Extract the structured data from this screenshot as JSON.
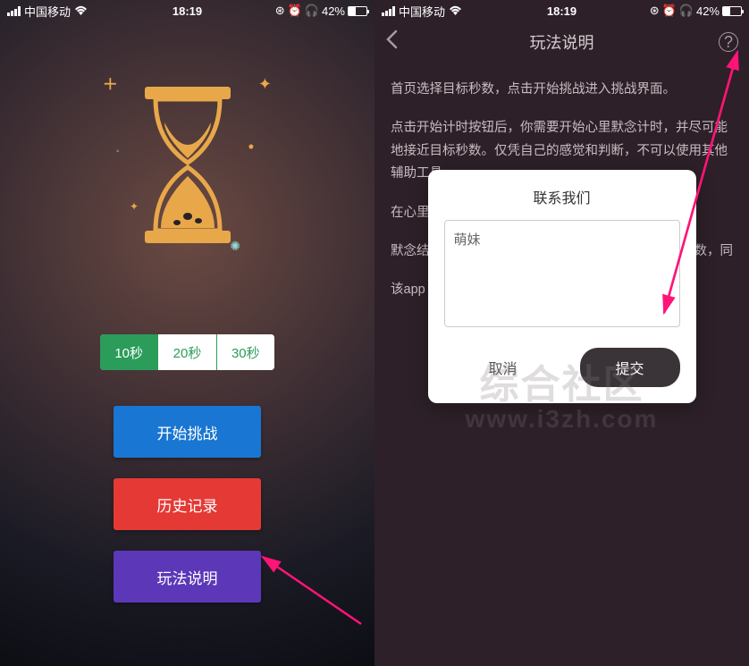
{
  "status": {
    "carrier": "中国移动",
    "time": "18:19",
    "battery_pct": "42%"
  },
  "left": {
    "segments": {
      "opt1": "10秒",
      "opt2": "20秒",
      "opt3": "30秒"
    },
    "buttons": {
      "start": "开始挑战",
      "history": "历史记录",
      "instructions": "玩法说明"
    }
  },
  "right": {
    "nav_title": "玩法说明",
    "instructions": {
      "p1": "首页选择目标秒数，点击开始挑战进入挑战界面。",
      "p2": "点击开始计时按钮后，你需要开始心里默念计时，并尽可能地接近目标秒数。仅凭自己的感觉和判断，不可以使用其他辅助工具。",
      "p3_partial": "在心里",
      "p4_partial_start": "默念结",
      "p4_partial_end": "战的秒数，同",
      "p5_partial": "该app"
    },
    "dialog": {
      "title": "联系我们",
      "input_value": "萌妹",
      "cancel": "取消",
      "submit": "提交"
    }
  },
  "watermark": {
    "line1": "综合社区",
    "line2": "www.i3zh.com"
  }
}
